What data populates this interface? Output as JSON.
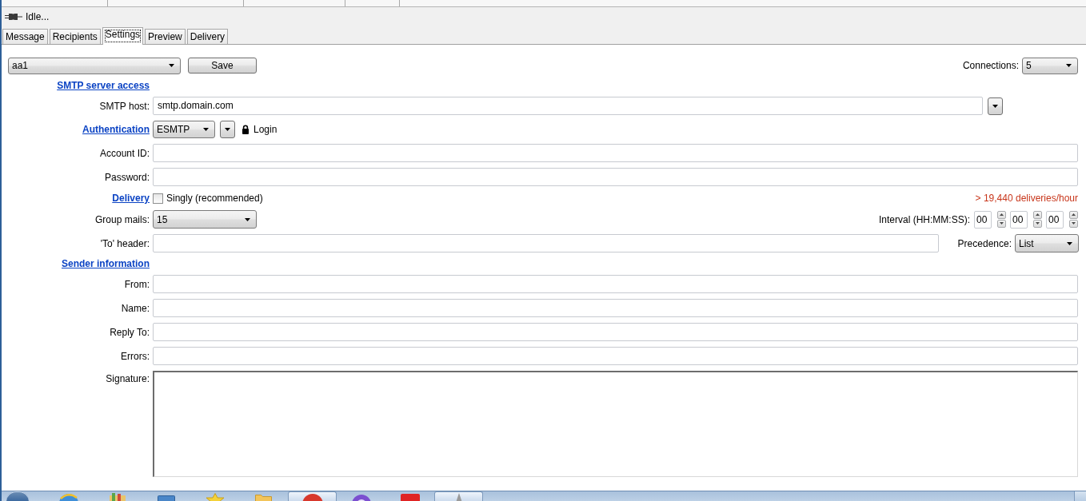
{
  "status": {
    "text": "Idle..."
  },
  "tabs": [
    {
      "label": "Message",
      "selected": false
    },
    {
      "label": "Recipients",
      "selected": false
    },
    {
      "label": "Settings",
      "selected": true
    },
    {
      "label": "Preview",
      "selected": false
    },
    {
      "label": "Delivery",
      "selected": false
    }
  ],
  "toolbar": {
    "profile": "aa1",
    "save_button": "Save",
    "connections": {
      "label": "Connections:",
      "value": "5"
    }
  },
  "form": [
    {
      "kind": "section",
      "label": "SMTP server access"
    },
    {
      "kind": "host",
      "label": "SMTP host:",
      "value": "smtp.domain.com"
    },
    {
      "kind": "auth",
      "label": "Authentication",
      "value": "ESMTP",
      "option": "Login"
    },
    {
      "kind": "field",
      "label": "Account ID:"
    },
    {
      "kind": "field",
      "label": "Password:"
    },
    {
      "kind": "delivery",
      "label": "Delivery",
      "checkbox": {
        "label": "Singly (recommended)",
        "checked": false
      },
      "rate": "> 19,440 deliveries/hour"
    },
    {
      "kind": "group",
      "label": "Group mails:",
      "value": "15",
      "interval": {
        "label": "Interval (HH:MM:SS):",
        "values": [
          "00",
          "00",
          "00"
        ]
      }
    },
    {
      "kind": "to",
      "label": "'To' header:",
      "precedence": {
        "label": "Precedence:",
        "value": "List"
      }
    },
    {
      "kind": "section",
      "label": "Sender information"
    },
    {
      "kind": "field",
      "label": "From:"
    },
    {
      "kind": "field",
      "label": "Name:"
    },
    {
      "kind": "field",
      "label": "Reply To:"
    },
    {
      "kind": "field",
      "label": "Errors:"
    },
    {
      "kind": "textarea",
      "label": "Signature:"
    }
  ],
  "taskbar": {
    "buttons": [
      {
        "kind": "globe",
        "active": false
      },
      {
        "kind": "books",
        "active": false
      },
      {
        "kind": "window",
        "active": false
      },
      {
        "kind": "star",
        "active": false
      },
      {
        "kind": "folder",
        "active": false
      },
      {
        "kind": "record",
        "active": true
      },
      {
        "kind": "chat",
        "active": false
      },
      {
        "kind": "video",
        "active": false
      },
      {
        "kind": "pen",
        "active": true
      }
    ]
  }
}
